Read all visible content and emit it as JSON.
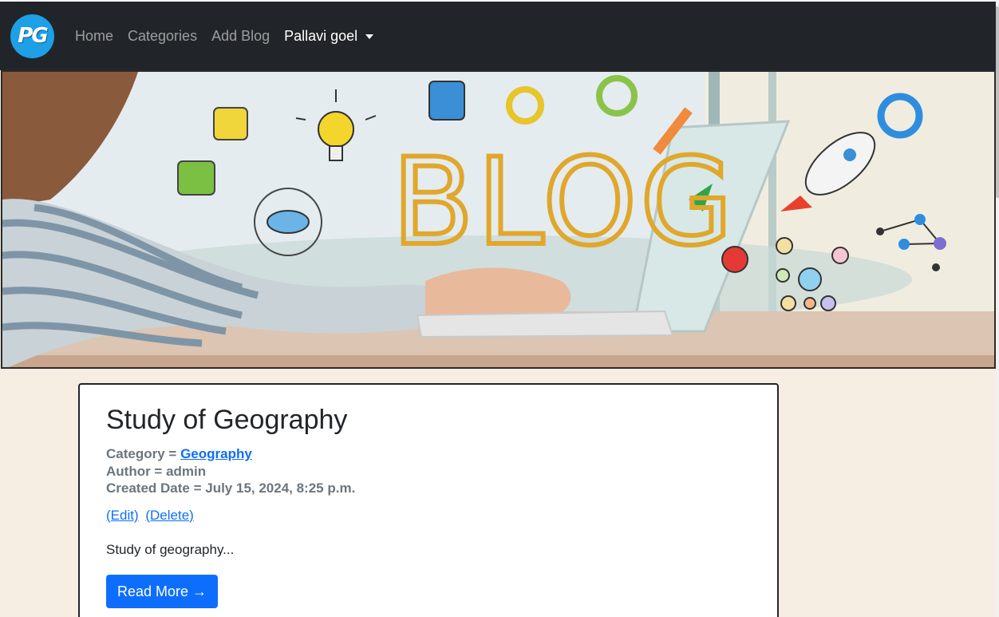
{
  "navbar": {
    "logo_text": "PG",
    "links": [
      "Home",
      "Categories",
      "Add Blog"
    ],
    "user": "Pallavi goel"
  },
  "banner": {
    "headline": "BLOG"
  },
  "post": {
    "title": "Study of Geography",
    "category_label": "Category = ",
    "category_value": "Geography",
    "author_line": "Author = admin",
    "date_line": "Created Date = July 15, 2024, 8:25 p.m.",
    "edit_label": "(Edit)",
    "delete_label": "(Delete)",
    "excerpt": "Study of geography...",
    "read_more": "Read More →"
  },
  "colors": {
    "navbar": "#212529",
    "page_bg": "#f6ede3",
    "primary": "#0d6efd",
    "logo_bg": "#1ea0e6"
  }
}
